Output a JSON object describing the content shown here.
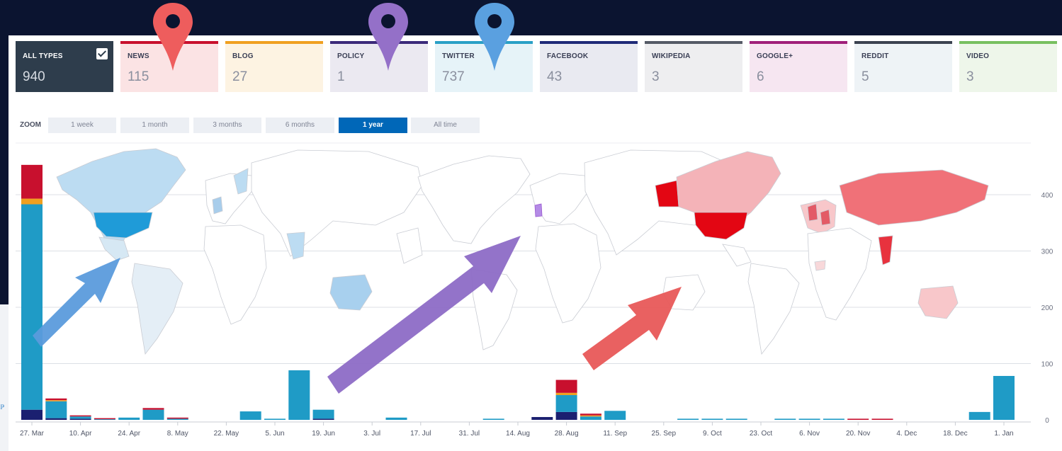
{
  "type_tiles": [
    {
      "label": "ALL TYPES",
      "count": "940",
      "color": "#2e3d4c",
      "bg": "#2e3d4c",
      "active": true
    },
    {
      "label": "NEWS",
      "count": "115",
      "color": "#c8102e",
      "bg": "#fbe3e4"
    },
    {
      "label": "BLOG",
      "count": "27",
      "color": "#f0a020",
      "bg": "#fdf3e2"
    },
    {
      "label": "POLICY",
      "count": "1",
      "color": "#3b2a7a",
      "bg": "#ebe9f1"
    },
    {
      "label": "TWITTER",
      "count": "737",
      "color": "#29a0c6",
      "bg": "#e6f3f8"
    },
    {
      "label": "FACEBOOK",
      "count": "43",
      "color": "#1f2a78",
      "bg": "#e9eaf1"
    },
    {
      "label": "WIKIPEDIA",
      "count": "3",
      "color": "#555a66",
      "bg": "#eeeef0"
    },
    {
      "label": "GOOGLE+",
      "count": "6",
      "color": "#a0207a",
      "bg": "#f6e6f1"
    },
    {
      "label": "REDDIT",
      "count": "5",
      "color": "#3b4250",
      "bg": "#eef3f6"
    },
    {
      "label": "VIDEO",
      "count": "3",
      "color": "#78c060",
      "bg": "#eef6ea"
    }
  ],
  "zoom": {
    "label": "ZOOM",
    "options": [
      "1 week",
      "1 month",
      "3 months",
      "6 months",
      "1 year",
      "All time"
    ],
    "selected": "1 year"
  },
  "colors": {
    "news": "#c8102e",
    "blog": "#f0a020",
    "twitter": "#1f9bc6",
    "facebook": "#1b2070",
    "policy": "#9b59d0",
    "highlight": "#8e6fce",
    "pin_red": "#e85a5a",
    "pin_purple": "#9470c8",
    "pin_blue": "#5aa0e0"
  },
  "icons": {
    "pins": [
      "map-pin-red",
      "map-pin-purple",
      "map-pin-blue"
    ],
    "arrows": [
      "arrow-blue",
      "arrow-purple",
      "arrow-red"
    ]
  },
  "chart_data": {
    "type": "bar",
    "stacked": true,
    "x_ticks": [
      "27. Mar",
      "10. Apr",
      "24. Apr",
      "8. May",
      "22. May",
      "5. Jun",
      "19. Jun",
      "3. Jul",
      "17. Jul",
      "31. Jul",
      "14. Aug",
      "28. Aug",
      "11. Sep",
      "25. Sep",
      "9. Oct",
      "23. Oct",
      "6. Nov",
      "20. Nov",
      "4. Dec",
      "18. Dec",
      "1. Jan"
    ],
    "y_ticks": [
      0,
      100,
      200,
      300,
      400
    ],
    "ylim": [
      0,
      470
    ],
    "grid": true,
    "legend": "none",
    "bars": [
      {
        "x": "27. Mar",
        "facebook": 18,
        "twitter": 365,
        "blog": 10,
        "news": 60
      },
      {
        "x": "3. Apr",
        "facebook": 3,
        "twitter": 30,
        "blog": 2,
        "news": 3
      },
      {
        "x": "10. Apr",
        "facebook": 2,
        "twitter": 4,
        "news": 2
      },
      {
        "x": "17. Apr",
        "twitter": 2,
        "news": 1
      },
      {
        "x": "24. Apr",
        "twitter": 4
      },
      {
        "x": "1. May",
        "twitter": 18,
        "news": 3
      },
      {
        "x": "8. May",
        "twitter": 2,
        "news": 2
      },
      {
        "x": "29. May",
        "twitter": 15
      },
      {
        "x": "5. Jun",
        "twitter": 2
      },
      {
        "x": "12. Jun",
        "twitter": 88
      },
      {
        "x": "19. Jun",
        "twitter": 16,
        "facebook": 2
      },
      {
        "x": "10. Jul",
        "twitter": 4
      },
      {
        "x": "7. Aug",
        "twitter": 2
      },
      {
        "x": "21. Aug",
        "facebook": 5
      },
      {
        "x": "28. Aug",
        "facebook": 14,
        "twitter": 30,
        "blog": 4,
        "news": 23
      },
      {
        "x": "4. Sep",
        "twitter": 6,
        "blog": 2,
        "news": 3
      },
      {
        "x": "11. Sep",
        "twitter": 16
      },
      {
        "x": "2. Oct",
        "twitter": 2
      },
      {
        "x": "9. Oct",
        "twitter": 2
      },
      {
        "x": "16. Oct",
        "twitter": 2
      },
      {
        "x": "30. Oct",
        "twitter": 2
      },
      {
        "x": "6. Nov",
        "twitter": 2
      },
      {
        "x": "13. Nov",
        "twitter": 2
      },
      {
        "x": "20. Nov",
        "news": 2
      },
      {
        "x": "27. Nov",
        "news": 2
      },
      {
        "x": "25. Dec",
        "twitter": 14
      },
      {
        "x": "1. Jan",
        "twitter": 78
      }
    ]
  }
}
